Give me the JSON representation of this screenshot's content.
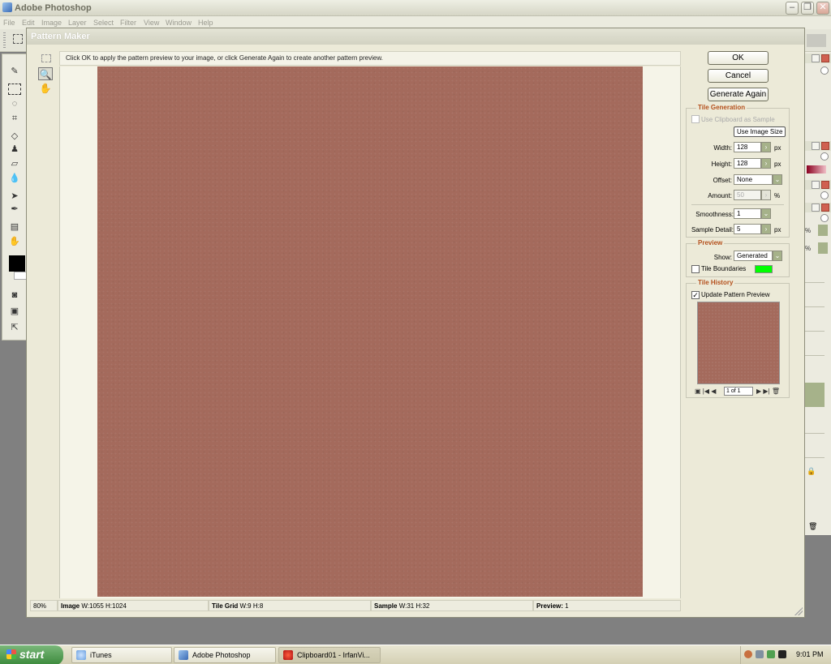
{
  "app": {
    "title": "Adobe Photoshop",
    "menu": [
      "File",
      "Edit",
      "Image",
      "Layer",
      "Select",
      "Filter",
      "View",
      "Window",
      "Help"
    ]
  },
  "dialog": {
    "title": "Pattern Maker",
    "hint": "Click OK to apply the pattern preview to your image, or click Generate Again to create another pattern preview.",
    "buttons": {
      "ok": "OK",
      "cancel": "Cancel",
      "generate_again": "Generate Again"
    },
    "tile_generation": {
      "title": "Tile Generation",
      "use_clipboard_label": "Use Clipboard as Sample",
      "use_clipboard_checked": false,
      "use_image_size_label": "Use Image Size",
      "width_label": "Width:",
      "width_value": "128",
      "height_label": "Height:",
      "height_value": "128",
      "unit_px": "px",
      "offset_label": "Offset:",
      "offset_value": "None",
      "amount_label": "Amount:",
      "amount_value": "50",
      "amount_unit": "%",
      "smoothness_label": "Smoothness:",
      "smoothness_value": "1",
      "sample_detail_label": "Sample Detail:",
      "sample_detail_value": "5"
    },
    "preview": {
      "title": "Preview",
      "show_label": "Show:",
      "show_value": "Generated",
      "tile_boundaries_label": "Tile Boundaries",
      "tile_boundaries_checked": false,
      "boundary_color": "#00ff00"
    },
    "tile_history": {
      "title": "Tile History",
      "update_label": "Update Pattern Preview",
      "update_checked": true,
      "page": "1 of 1"
    },
    "status": {
      "zoom": "80%",
      "image_label": "Image",
      "image_value": "W:1055 H:1024",
      "tile_grid_label": "Tile Grid",
      "tile_grid_value": "W:9 H:8",
      "sample_label": "Sample",
      "sample_value": "W:31 H:32",
      "preview_label": "Preview:",
      "preview_value": "1"
    },
    "pattern_color": "#a46a5c"
  },
  "right_palettes": {
    "pct1": "%",
    "pct2": "%"
  },
  "taskbar": {
    "start_label": "start",
    "tasks": [
      {
        "label": "iTunes",
        "active": false
      },
      {
        "label": "Adobe Photoshop",
        "active": false
      },
      {
        "label": "Clipboard01 - IrfanVi...",
        "active": true
      }
    ],
    "clock": "9:01 PM"
  }
}
